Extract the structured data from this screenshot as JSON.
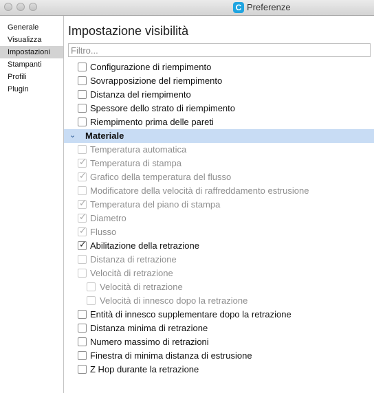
{
  "window": {
    "title": "Preferenze",
    "app_icon_letter": "C"
  },
  "sidebar": {
    "items": [
      {
        "label": "Generale"
      },
      {
        "label": "Visualizza"
      },
      {
        "label": "Impostazioni"
      },
      {
        "label": "Stampanti"
      },
      {
        "label": "Profili"
      },
      {
        "label": "Plugin"
      }
    ],
    "active_index": 2
  },
  "main": {
    "title": "Impostazione visibilità",
    "filter_placeholder": "Filtro...",
    "rows": [
      {
        "type": "setting",
        "label": "Configurazione di riempimento",
        "checked": false,
        "enabled": true,
        "indent": 1
      },
      {
        "type": "setting",
        "label": "Sovrapposizione del riempimento",
        "checked": false,
        "enabled": true,
        "indent": 1
      },
      {
        "type": "setting",
        "label": "Distanza del riempimento",
        "checked": false,
        "enabled": true,
        "indent": 1
      },
      {
        "type": "setting",
        "label": "Spessore dello strato di riempimento",
        "checked": false,
        "enabled": true,
        "indent": 1
      },
      {
        "type": "setting",
        "label": "Riempimento prima delle pareti",
        "checked": false,
        "enabled": true,
        "indent": 1
      },
      {
        "type": "group",
        "label": "Materiale",
        "expanded": true
      },
      {
        "type": "setting",
        "label": "Temperatura automatica",
        "checked": false,
        "enabled": false,
        "indent": 1
      },
      {
        "type": "setting",
        "label": "Temperatura di stampa",
        "checked": true,
        "enabled": false,
        "indent": 1
      },
      {
        "type": "setting",
        "label": "Grafico della temperatura del flusso",
        "checked": true,
        "enabled": false,
        "indent": 1
      },
      {
        "type": "setting",
        "label": "Modificatore della velocità di raffreddamento estrusione",
        "checked": false,
        "enabled": false,
        "indent": 1
      },
      {
        "type": "setting",
        "label": "Temperatura del piano di stampa",
        "checked": true,
        "enabled": false,
        "indent": 1
      },
      {
        "type": "setting",
        "label": "Diametro",
        "checked": true,
        "enabled": false,
        "indent": 1
      },
      {
        "type": "setting",
        "label": "Flusso",
        "checked": true,
        "enabled": false,
        "indent": 1
      },
      {
        "type": "setting",
        "label": "Abilitazione della retrazione",
        "checked": true,
        "enabled": true,
        "indent": 1
      },
      {
        "type": "setting",
        "label": "Distanza di retrazione",
        "checked": false,
        "enabled": false,
        "indent": 1
      },
      {
        "type": "setting",
        "label": "Velocità di retrazione",
        "checked": false,
        "enabled": false,
        "indent": 1
      },
      {
        "type": "setting",
        "label": "Velocità di retrazione",
        "checked": false,
        "enabled": false,
        "indent": 2
      },
      {
        "type": "setting",
        "label": "Velocità di innesco dopo la retrazione",
        "checked": false,
        "enabled": false,
        "indent": 2
      },
      {
        "type": "setting",
        "label": "Entità di innesco supplementare dopo la retrazione",
        "checked": false,
        "enabled": true,
        "indent": 1
      },
      {
        "type": "setting",
        "label": "Distanza minima di retrazione",
        "checked": false,
        "enabled": true,
        "indent": 1
      },
      {
        "type": "setting",
        "label": "Numero massimo di retrazioni",
        "checked": false,
        "enabled": true,
        "indent": 1
      },
      {
        "type": "setting",
        "label": "Finestra di minima distanza di estrusione",
        "checked": false,
        "enabled": true,
        "indent": 1
      },
      {
        "type": "setting",
        "label": "Z Hop durante la retrazione",
        "checked": false,
        "enabled": true,
        "indent": 1
      }
    ]
  },
  "icons": {
    "group_toggle": "chevron-down-icon",
    "check": "checkmark-icon"
  },
  "colors": {
    "group_background": "#c8dcf4",
    "app_icon": "#1fa4e0",
    "selected_sidebar": "#d3d3d3"
  }
}
